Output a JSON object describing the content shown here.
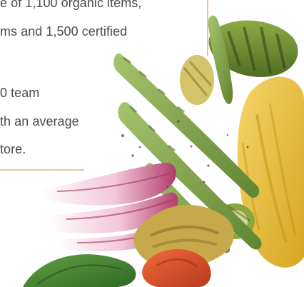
{
  "copy": {
    "line1": "e of 1,100 organic items,",
    "line2": "ms and 1,500 certified",
    "line3": "0 team",
    "line4": "th an average",
    "line5": "tore."
  },
  "image": {
    "subject": "Grilled vegetables: asparagus, corn, zucchini, red onion, tomato, basil"
  },
  "colors": {
    "text": "#4b4b4b",
    "divider": "#c48a46",
    "asparagus": "#7aa047",
    "zucchini": "#6b8f2f",
    "corn": "#e8c24a",
    "onion": "#c24b73",
    "tomato": "#e0562c",
    "basil": "#3f7f2d"
  }
}
